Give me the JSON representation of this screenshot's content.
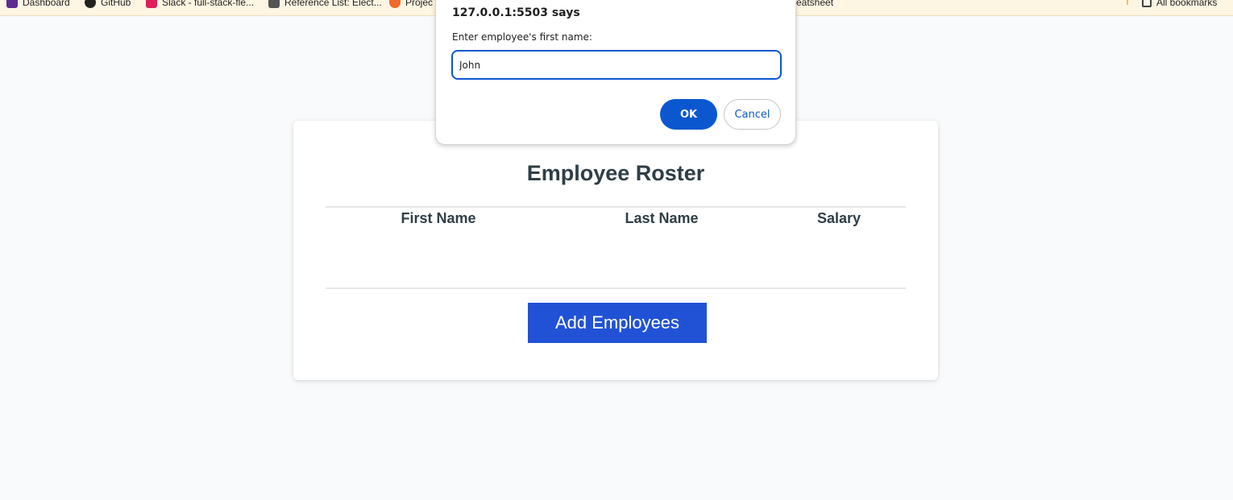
{
  "bookmarks": {
    "items": [
      {
        "label": "Dashboard",
        "icon": "dashboard-icon",
        "color": "#5b2d90"
      },
      {
        "label": "GitHub",
        "icon": "github-icon",
        "color": "#222222"
      },
      {
        "label": "Slack - full-stack-fle...",
        "icon": "slack-icon",
        "color": "#e01e5a"
      },
      {
        "label": "Reference List: Elect...",
        "icon": "document-icon",
        "color": "#444444"
      },
      {
        "label": "Projec",
        "icon": "shield-icon",
        "color": "#f06a2a"
      },
      {
        "label": "eatsheet"
      }
    ],
    "all_bookmarks": {
      "label": "All bookmarks",
      "icon": "folder-icon"
    }
  },
  "dialog": {
    "title": "127.0.0.1:5503 says",
    "message": "Enter employee's first name:",
    "input_value": "John",
    "ok_label": "OK",
    "cancel_label": "Cancel"
  },
  "roster": {
    "title": "Employee Roster",
    "columns": [
      "First Name",
      "Last Name",
      "Salary"
    ],
    "rows": [],
    "add_button_label": "Add Employees"
  },
  "colors": {
    "accent": "#2152d6",
    "dialog_accent": "#0b57d0",
    "heading": "#2f3e46",
    "page_background": "#f8fafc"
  }
}
